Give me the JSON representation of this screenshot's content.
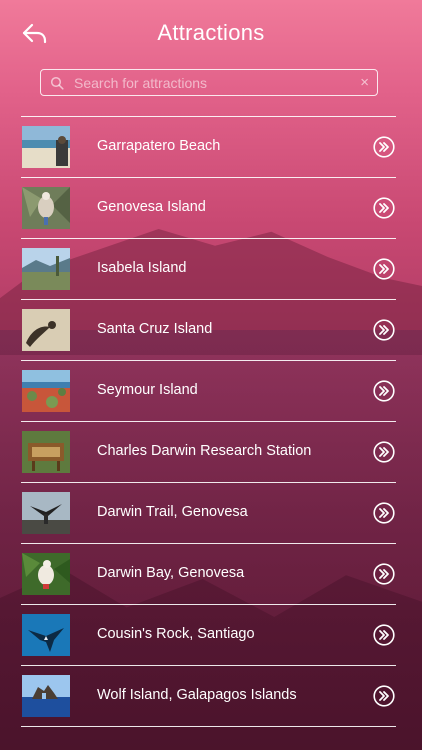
{
  "header": {
    "title": "Attractions",
    "back_icon": "back-arrow-icon"
  },
  "search": {
    "placeholder": "Search for attractions",
    "value": "",
    "search_icon": "search-icon",
    "clear_symbol": "×"
  },
  "colors": {
    "background_top": "#f07a9a",
    "background_bottom": "#6f2042",
    "text": "#ffffff",
    "divider": "#ffffff"
  },
  "attractions": [
    {
      "name": "Garrapatero Beach",
      "thumb_icon": "beach-photo"
    },
    {
      "name": "Genovesa Island",
      "thumb_icon": "bird-photo"
    },
    {
      "name": "Isabela Island",
      "thumb_icon": "coastline-photo"
    },
    {
      "name": "Santa Cruz Island",
      "thumb_icon": "sea-lion-photo"
    },
    {
      "name": "Seymour Island",
      "thumb_icon": "island-vegetation-photo"
    },
    {
      "name": "Charles Darwin Research Station",
      "thumb_icon": "station-sign-photo"
    },
    {
      "name": "Darwin Trail, Genovesa",
      "thumb_icon": "frigatebird-photo"
    },
    {
      "name": "Darwin Bay, Genovesa",
      "thumb_icon": "booby-photo"
    },
    {
      "name": "Cousin's Rock, Santiago",
      "thumb_icon": "manta-ray-photo"
    },
    {
      "name": "Wolf Island, Galapagos Islands",
      "thumb_icon": "rock-island-photo"
    }
  ],
  "row_action_icon": "chevron-double-right-circle-icon"
}
